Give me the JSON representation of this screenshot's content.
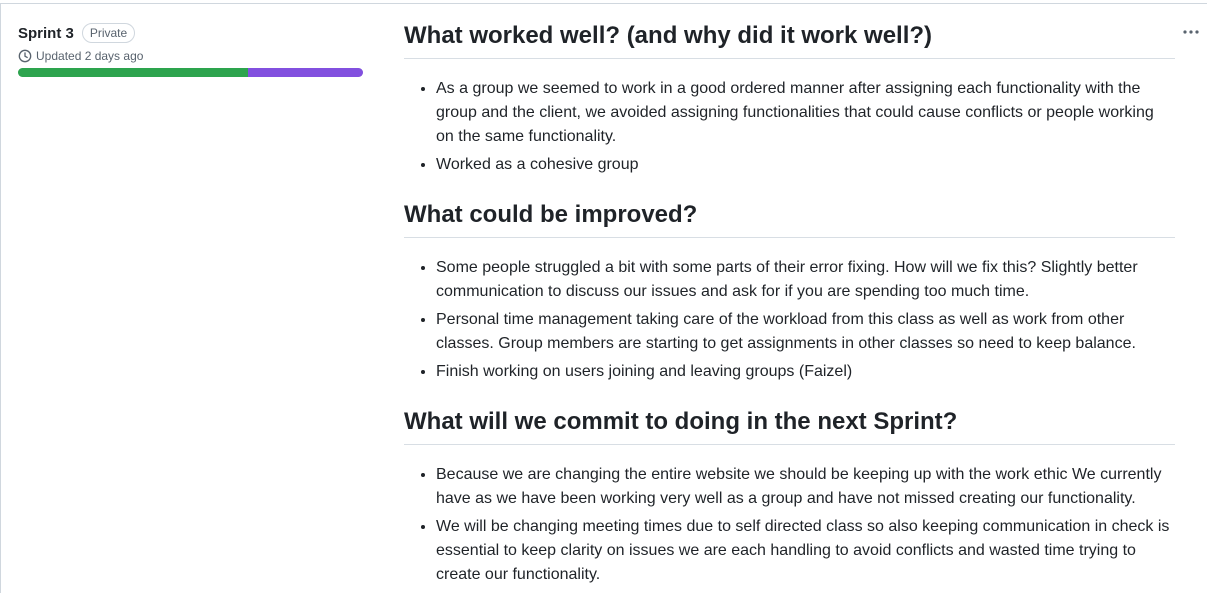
{
  "milestone": {
    "title": "Sprint 3",
    "visibility": "Private",
    "updated": "Updated 2 days ago",
    "progress": {
      "completed_fraction": 0.667,
      "in_progress_fraction": 0.333
    },
    "colors": {
      "completed": "#2da44e",
      "in_progress": "#8250df"
    }
  },
  "menu": {
    "icon": "kebab-horizontal-icon"
  },
  "sections": [
    {
      "heading": "What worked well? (and why did it work well?)",
      "items": [
        "As a group we seemed to work in a good ordered manner after assigning each functionality with the group and the client, we avoided assigning functionalities that could cause conflicts or people working on the same functionality.",
        "Worked as a cohesive group"
      ]
    },
    {
      "heading": "What could be improved?",
      "items": [
        "Some people struggled a bit with some parts of their error fixing. How will we fix this? Slightly better communication to discuss our issues and ask for if you are spending too much time.",
        "Personal time management taking care of the workload from this class as well as work from other classes. Group members are starting to get assignments in other classes so need to keep balance.",
        "Finish working on users joining and leaving groups (Faizel)"
      ]
    },
    {
      "heading": "What will we commit to doing in the next Sprint?",
      "items": [
        "Because we are changing the entire website we should be keeping up with the work ethic We currently have as we have been working very well as a group and have not missed creating our functionality.",
        "We will be changing meeting times due to self directed class so also keeping communication in check is essential to keep clarity on issues we are each handling to avoid conflicts and wasted time trying to create our functionality."
      ]
    }
  ]
}
